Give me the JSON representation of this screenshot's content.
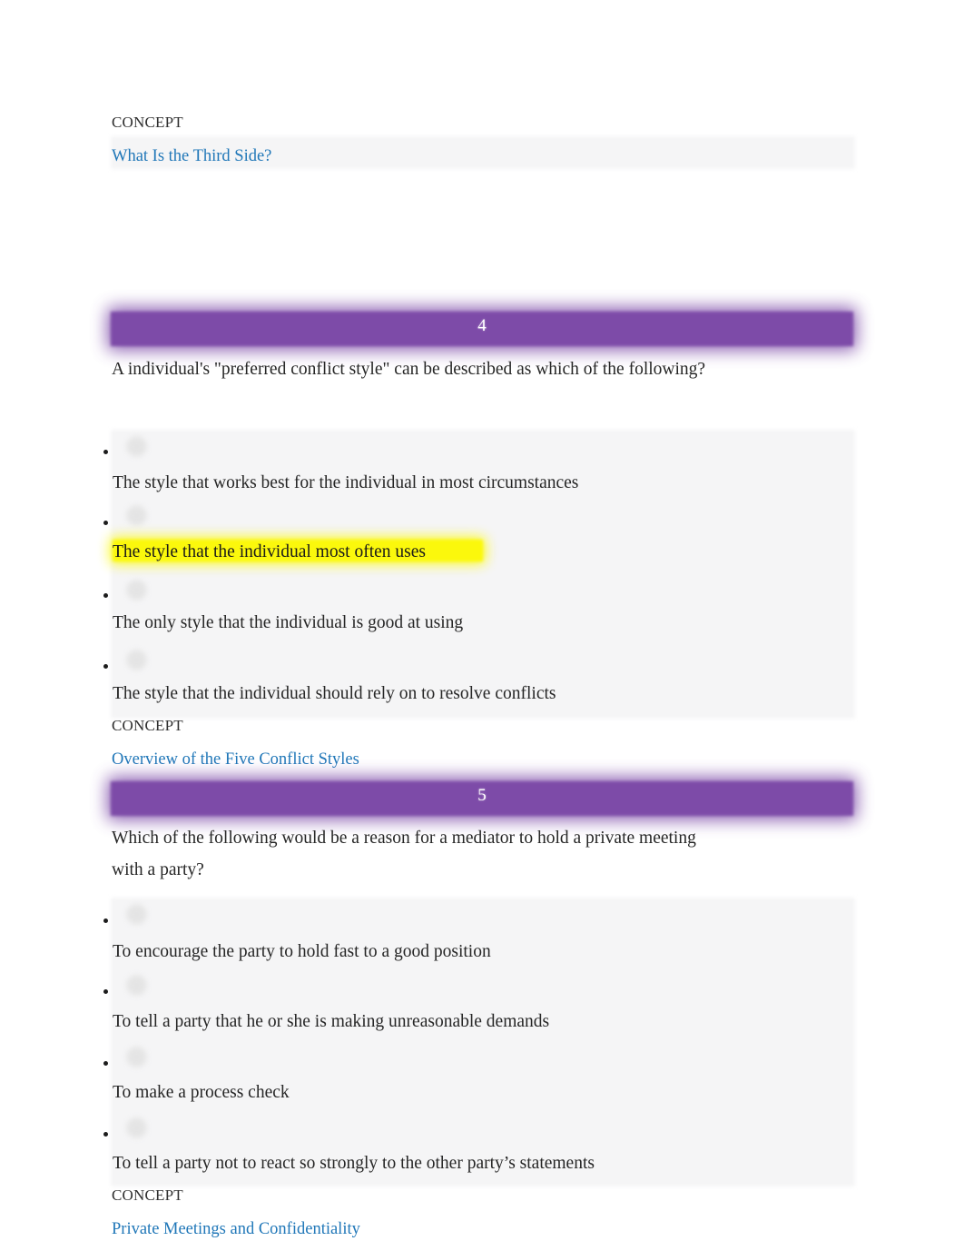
{
  "document": {
    "type": "quiz-review",
    "font_family_class": "serif"
  },
  "colors": {
    "question_header_purple": "#7d4ba8",
    "concept_link_blue": "#2077b8",
    "highlight_yellow": "#fbf80c",
    "panel_gray": "#f5f5f6",
    "body_text": "#262626"
  },
  "top_concept": {
    "label": "CONCEPT",
    "link": "What Is the Third Side?"
  },
  "questions": [
    {
      "number": "4",
      "prompt": "A individual's \"preferred conflict style\" can be described as which of the following?",
      "options": [
        {
          "text": "The style that works best for the individual in most circumstances",
          "highlighted": false
        },
        {
          "text": "The style that the individual most often uses",
          "highlighted": true
        },
        {
          "text": "The only style that the individual is good at using",
          "highlighted": false
        },
        {
          "text": "The style that the individual should rely on to resolve conflicts",
          "highlighted": false
        }
      ],
      "concept": {
        "label": "CONCEPT",
        "link": "Overview of the Five Conflict Styles"
      }
    },
    {
      "number": "5",
      "prompt": "Which of the following would be a reason for a mediator to hold a private meeting with a party?",
      "options": [
        {
          "text": "To encourage the party to hold fast to a good position",
          "highlighted": false
        },
        {
          "text": "To tell a party that he or she is making unreasonable demands",
          "highlighted": false
        },
        {
          "text": "To make a process check",
          "highlighted": false
        },
        {
          "text": "To tell a party not to react so strongly to the other party’s statements",
          "highlighted": false
        }
      ],
      "concept": {
        "label": "CONCEPT",
        "link": "Private Meetings and Confidentiality"
      }
    }
  ]
}
